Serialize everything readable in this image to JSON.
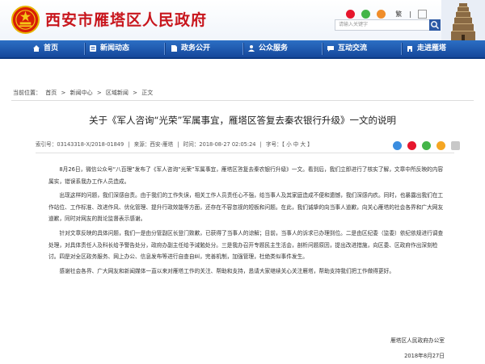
{
  "header": {
    "site_title": "西安市雁塔区人民政府",
    "top_link": "繁",
    "search_placeholder": "请输入关键字"
  },
  "nav": {
    "items": [
      {
        "label": "首页",
        "icon": "home-icon"
      },
      {
        "label": "新闻动态",
        "icon": "news-icon"
      },
      {
        "label": "政务公开",
        "icon": "document-icon"
      },
      {
        "label": "公众服务",
        "icon": "service-icon"
      },
      {
        "label": "互动交流",
        "icon": "chat-icon"
      },
      {
        "label": "走进雁塔",
        "icon": "building-icon"
      }
    ]
  },
  "breadcrumb": {
    "prefix": "当前位置：",
    "items": [
      "首页",
      "新闻中心",
      "区域新闻",
      "正文"
    ],
    "separator": ">"
  },
  "article": {
    "title": "关于《军人咨询“光荣”军属事宜，雁塔区答复去秦农银行升级》一文的说明",
    "meta": {
      "index": "索引号：03143318-X/2018-01849",
      "source": "来源：西安-雁塔",
      "time": "时间：2018-08-27 02:05:24",
      "font_size": "字号：【 小 中 大 】"
    },
    "paragraphs": [
      "8月26日，微信公众号“八百理”发布了《军人咨询“光荣”军属事宜，雁塔区答复去秦农银行升级》一文。看到后，我们立即进行了核实了解，文章中所反映的内容属实，错误系我办工作人员造成。",
      "出现这样的问题，我们深感自责。由于我们的工作失误，相关工作人员责任心不强，给当事人及其家庭造成不便和遗憾，我们深感内疚。同时，也暴露出我们在工作站位、工作标准、改进作风、优化管理、提升行政效能等方面，还存在不容忽视的短板和问题。在此，我们诚挚的向当事人道歉，向关心雁塔的社会各界和广大网友道歉，同时对网友的舆论监督表示感谢。",
      "针对文章反映的具体问题，我们一是由分管副区长登门致歉，已获得了当事人的谅解；目前，当事人的诉求已办理到位。二是由区纪委（监委）依纪依规进行调查处理，对具体责任人及科长给予警告处分，政府办副主任给予诫勉处分。三是我办召开专题民主生活会，剖析问题原因，提出改进措施，向区委、区政府作出深刻检讨。四是对全区政务服务、网上办公、信息发布等进行自查自纠，完善机制，加强管理，杜绝类似事件发生。",
      "感谢社会各界、广大网友和新闻媒体一直以来对雁塔工作的关注、帮助和支持，恳请大家继续关心关注雁塔，帮助支持我们把工作做得更好。"
    ],
    "signature": "雁塔区人民政府办公室",
    "date": "2018年8月27日"
  },
  "colors": {
    "brand_red": "#c8161d",
    "nav_blue": "#1a56b0"
  }
}
